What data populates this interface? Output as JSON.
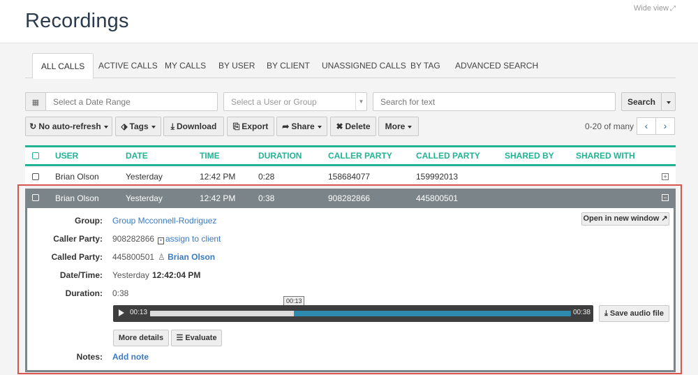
{
  "header": {
    "title": "Recordings",
    "wide_view": "Wide view"
  },
  "tabs": [
    {
      "label": "ALL CALLS",
      "active": true
    },
    {
      "label": "ACTIVE CALLS"
    },
    {
      "label": "MY CALLS"
    },
    {
      "label": "BY USER"
    },
    {
      "label": "BY CLIENT"
    },
    {
      "label": "UNASSIGNED CALLS"
    },
    {
      "label": "BY TAG"
    },
    {
      "label": "ADVANCED SEARCH"
    }
  ],
  "filters": {
    "date_placeholder": "Select a Date Range",
    "user_placeholder": "Select a User or Group",
    "search_placeholder": "Search for text",
    "search_button": "Search"
  },
  "toolbar": {
    "auto_refresh": "No auto-refresh",
    "tags": "Tags",
    "download": "Download",
    "export": "Export",
    "share": "Share",
    "delete": "Delete",
    "more": "More",
    "pager_count": "0-20 of many"
  },
  "table": {
    "columns": [
      "USER",
      "DATE",
      "TIME",
      "DURATION",
      "CALLER PARTY",
      "CALLED PARTY",
      "SHARED BY",
      "SHARED WITH"
    ],
    "rows": [
      [
        "Brian Olson",
        "Yesterday",
        "12:42 PM",
        "0:28",
        "158684077",
        "159992013"
      ],
      [
        "Brian Olson",
        "Yesterday",
        "12:42 PM",
        "0:38",
        "908282866",
        "445800501"
      ]
    ]
  },
  "detail": {
    "group_label": "Group:",
    "group_value": "Group Mcconnell-Rodriguez",
    "caller_label": "Caller Party:",
    "caller_value": "908282866",
    "assign_link": "assign to client",
    "called_label": "Called Party:",
    "called_value": "445800501",
    "called_user": "Brian Olson",
    "datetime_label": "Date/Time:",
    "date_value": "Yesterday",
    "time_value": "12:42:04 PM",
    "duration_label": "Duration:",
    "duration_value": "0:38",
    "open_new_window": "Open in new window",
    "notes_label": "Notes:",
    "add_note": "Add note",
    "more_details": "More details",
    "evaluate": "Evaluate",
    "save_audio": "Save audio file"
  },
  "player": {
    "current_time": "00:13",
    "total_time": "00:38",
    "tooltip_time": "00:13",
    "progress_fraction": 0.342
  },
  "colors": {
    "accent": "#20b394",
    "link": "#3a7ac2",
    "selected_row": "#7b8488",
    "highlight_border": "#d9534f"
  }
}
